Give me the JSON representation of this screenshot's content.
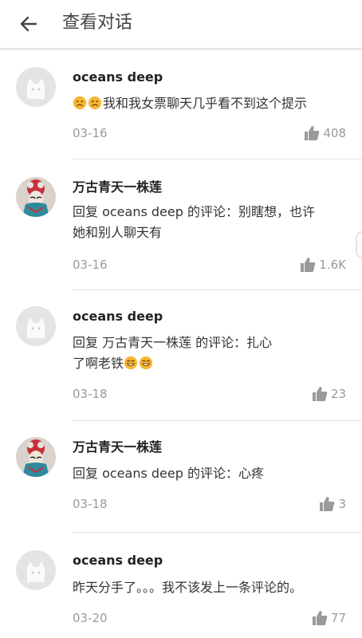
{
  "header": {
    "title": "查看对话"
  },
  "comments": [
    {
      "user": "oceans deep",
      "avatar": "default-cat",
      "emoji": [
        "sad-face",
        "sad-face"
      ],
      "text": "我和我女票聊天几乎看不到这个提示",
      "date": "03-16",
      "likes": "408"
    },
    {
      "user": "万古青天一株莲",
      "avatar": "opera-mask",
      "text_line1": "回复 oceans deep 的评论：别瞎想，也许",
      "text_line2": "她和别人聊天有",
      "date": "03-16",
      "likes": "1.6K"
    },
    {
      "user": "oceans deep",
      "avatar": "default-cat",
      "text_line1": "回复 万古青天一株莲 的评论：扎心",
      "text_line2": "了啊老铁",
      "emoji": [
        "grin-face",
        "grin-face"
      ],
      "date": "03-18",
      "likes": "23"
    },
    {
      "user": "万古青天一株莲",
      "avatar": "opera-mask",
      "text": "回复 oceans deep 的评论：心疼",
      "date": "03-18",
      "likes": "3"
    },
    {
      "user": "oceans deep",
      "avatar": "default-cat",
      "text": "昨天分手了。。。我不该发上一条评论的。",
      "date": "03-20",
      "likes": "77"
    }
  ],
  "colors": {
    "meta": "#9a9a9a",
    "divider": "#e6e6e6",
    "emoji": "#f6b533"
  }
}
